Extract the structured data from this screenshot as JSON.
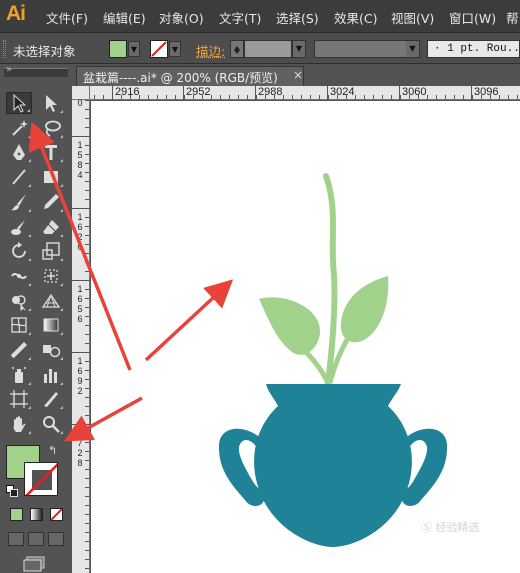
{
  "app": {
    "logo_text": "Ai"
  },
  "menu": [
    {
      "key": "file",
      "label": "文件(F)"
    },
    {
      "key": "edit",
      "label": "编辑(E)"
    },
    {
      "key": "object",
      "label": "对象(O)"
    },
    {
      "key": "type",
      "label": "文字(T)"
    },
    {
      "key": "select",
      "label": "选择(S)"
    },
    {
      "key": "effect",
      "label": "效果(C)"
    },
    {
      "key": "view",
      "label": "视图(V)"
    },
    {
      "key": "window",
      "label": "窗口(W)"
    },
    {
      "key": "help",
      "label": "帮"
    }
  ],
  "controlbar": {
    "selection_status": "未选择对象",
    "stroke_label": "描边:",
    "brush_value": "·  1 pt. Rou..",
    "fill_color": "#a1d28b",
    "stroke_color": "none"
  },
  "document": {
    "tab_title": "盆栽篇----.ai* @ 200% (RGB/预览)",
    "close_glyph": "×",
    "zoom": "200%",
    "color_mode": "RGB/预览"
  },
  "ruler": {
    "h_labels": [
      "2916",
      "2952",
      "2988",
      "3024",
      "3060",
      "3096"
    ],
    "v_labels": [
      "0",
      "1584",
      "1620",
      "1656",
      "1692",
      "1728"
    ]
  },
  "tools": [
    {
      "name": "selection-tool-icon",
      "selected": true
    },
    {
      "name": "direct-selection-tool-icon",
      "selected": false
    },
    {
      "name": "magic-wand-tool-icon",
      "selected": false
    },
    {
      "name": "lasso-tool-icon",
      "selected": false
    },
    {
      "name": "pen-tool-icon",
      "selected": false
    },
    {
      "name": "type-tool-icon",
      "selected": false
    },
    {
      "name": "line-segment-tool-icon",
      "selected": false
    },
    {
      "name": "rectangle-tool-icon",
      "selected": false
    },
    {
      "name": "paintbrush-tool-icon",
      "selected": false
    },
    {
      "name": "pencil-tool-icon",
      "selected": false
    },
    {
      "name": "blob-brush-tool-icon",
      "selected": false
    },
    {
      "name": "eraser-tool-icon",
      "selected": false
    },
    {
      "name": "rotate-tool-icon",
      "selected": false
    },
    {
      "name": "scale-tool-icon",
      "selected": false
    },
    {
      "name": "width-tool-icon",
      "selected": false
    },
    {
      "name": "free-transform-tool-icon",
      "selected": false
    },
    {
      "name": "shape-builder-tool-icon",
      "selected": false
    },
    {
      "name": "perspective-grid-tool-icon",
      "selected": false
    },
    {
      "name": "mesh-tool-icon",
      "selected": false
    },
    {
      "name": "gradient-tool-icon",
      "selected": false
    },
    {
      "name": "eyedropper-tool-icon",
      "selected": false
    },
    {
      "name": "blend-tool-icon",
      "selected": false
    },
    {
      "name": "symbol-sprayer-tool-icon",
      "selected": false
    },
    {
      "name": "column-graph-tool-icon",
      "selected": false
    },
    {
      "name": "artboard-tool-icon",
      "selected": false
    },
    {
      "name": "slice-tool-icon",
      "selected": false
    },
    {
      "name": "hand-tool-icon",
      "selected": false
    },
    {
      "name": "zoom-tool-icon",
      "selected": false
    }
  ],
  "toolbox": {
    "fill_color": "#a1d28b",
    "stroke_swatch": "none",
    "swap_glyph": "↰"
  },
  "artwork": {
    "pot_color": "#1f8297",
    "leaf_color": "#a1d28b",
    "annotation_arrow_color": "#e8423b"
  },
  "watermark": "Ⓢ 经验精选"
}
